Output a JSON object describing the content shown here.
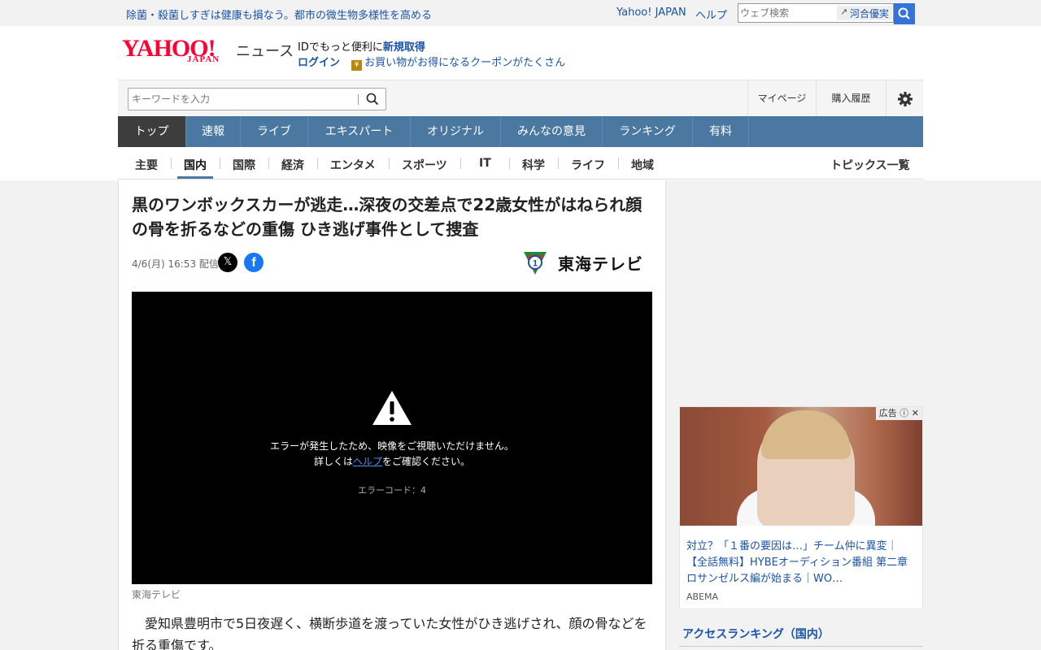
{
  "topbar": {
    "promo": "除菌・殺菌しすぎは健康も損なう。都市の微生物多様性を高める",
    "yahoo_japan": "Yahoo! JAPAN",
    "help": "ヘルプ",
    "web_search_placeholder": "ウェブ検索",
    "trend_word": "河合優実"
  },
  "header": {
    "logo_yahoo": "YAHOO!",
    "logo_japan": "JAPAN",
    "logo_news": "ニュース",
    "id_text": "IDでもっと便利に",
    "signup": "新規取得",
    "login": "ログイン",
    "coupon": "お買い物がお得になるクーポンがたくさん"
  },
  "search": {
    "placeholder": "キーワードを入力",
    "mypage": "マイページ",
    "history": "購入履歴"
  },
  "nav": {
    "tabs": [
      "トップ",
      "速報",
      "ライブ",
      "エキスパート",
      "オリジナル",
      "みんなの意見",
      "ランキング",
      "有料"
    ]
  },
  "subnav": {
    "items": [
      "主要",
      "国内",
      "国際",
      "経済",
      "エンタメ",
      "スポーツ",
      "IT",
      "科学",
      "ライフ",
      "地域"
    ],
    "active": "国内",
    "topics": "トピックス一覧"
  },
  "article": {
    "title": "黒のワンボックスカーが逃走…深夜の交差点で22歳女性がはねられ顔の骨を折るなどの重傷 ひき逃げ事件として捜査",
    "date": "4/6(月) 16:53 配信",
    "source": "東海テレビ",
    "video_error_line1": "エラーが発生したため、映像をご視聴いただけません。",
    "video_error_pre": "詳しくは",
    "video_error_link": "ヘルプ",
    "video_error_post": "をご確認ください。",
    "video_error_code": "エラーコード：4",
    "caption": "東海テレビ",
    "body": "愛知県豊明市で5日夜遅く、横断歩道を渡っていた女性がひき逃げされ、顔の骨などを折る重傷です。"
  },
  "ad": {
    "label": "広告",
    "title": "対立？「１番の要因は…」チーム仲に異変｜【全話無料】HYBEオーディション番組 第二章 ロサンゼルス編が始まる｜WO…",
    "sponsor": "ABEMA"
  },
  "ranking": {
    "title": "アクセスランキング（国内）"
  },
  "colors": {
    "nav_bg": "#4b78a1",
    "link": "#1a53a8",
    "brand_red": "#ff0033"
  }
}
